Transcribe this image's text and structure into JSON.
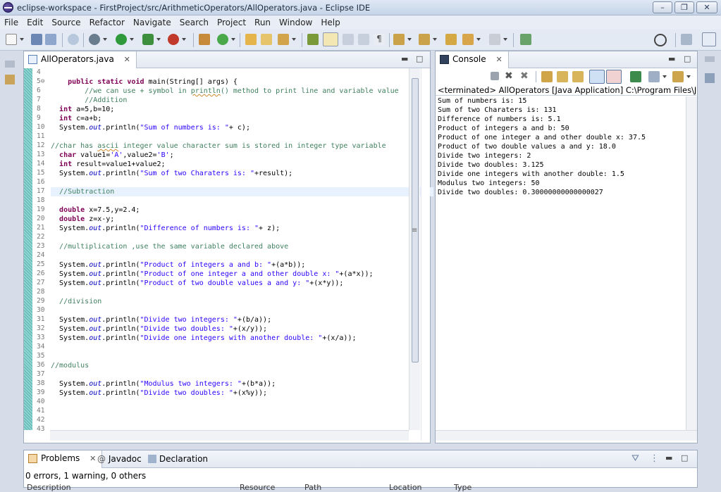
{
  "window": {
    "title": "eclipse-workspace - FirstProject/src/ArithmeticOperators/AllOperators.java - Eclipse IDE",
    "minimize_symbol": "–",
    "restore_symbol": "❐",
    "close_symbol": "✕"
  },
  "menu": [
    "File",
    "Edit",
    "Source",
    "Refactor",
    "Navigate",
    "Search",
    "Project",
    "Run",
    "Window",
    "Help"
  ],
  "editor": {
    "tab_label": "AllOperators.java",
    "tab_close": "✕",
    "overview_marker": "≡",
    "line_numbers": [
      "4",
      "5⊖",
      "6",
      "7",
      "8",
      "9",
      "10",
      "11",
      "12",
      "13",
      "14",
      "15",
      "16",
      "17",
      "18",
      "19",
      "20",
      "21",
      "22",
      "23",
      "24",
      "25",
      "26",
      "27",
      "28",
      "29",
      "30",
      "31",
      "32",
      "33",
      "34",
      "35",
      "36",
      "37",
      "38",
      "39",
      "40",
      "41",
      "42",
      "43"
    ],
    "current_line_index": 13
  },
  "console": {
    "tab_label": "Console",
    "tab_close": "✕",
    "terminated_text": "<terminated> AllOperators [Java Application] C:\\Program Files\\Java\\jdk",
    "lines": [
      "Sum of numbers is: 15",
      "Sum of two Charaters is: 131",
      "Difference of numbers is: 5.1",
      "Product of integers a and b: 50",
      "Product of one integer a and other double x: 37.5",
      "Product of two double values a and y: 18.0",
      "Divide two integers: 2",
      "Divide two doubles: 3.125",
      "Divide one integers with another double: 1.5",
      "Modulus two integers: 50",
      "Divide two doubles: 0.30000000000000027"
    ]
  },
  "bottom": {
    "tabs": [
      {
        "label": "Problems",
        "close": "✕"
      },
      {
        "label": "Javadoc"
      },
      {
        "label": "Declaration"
      }
    ],
    "status": "0 errors, 1 warning, 0 others",
    "col_headers": [
      "Description",
      "Resource",
      "Path",
      "Location",
      "Type"
    ]
  },
  "colors": {
    "keyword": "#7f0055",
    "comment": "#3f7f5f",
    "string": "#2a00ff",
    "field": "#0000c0"
  }
}
